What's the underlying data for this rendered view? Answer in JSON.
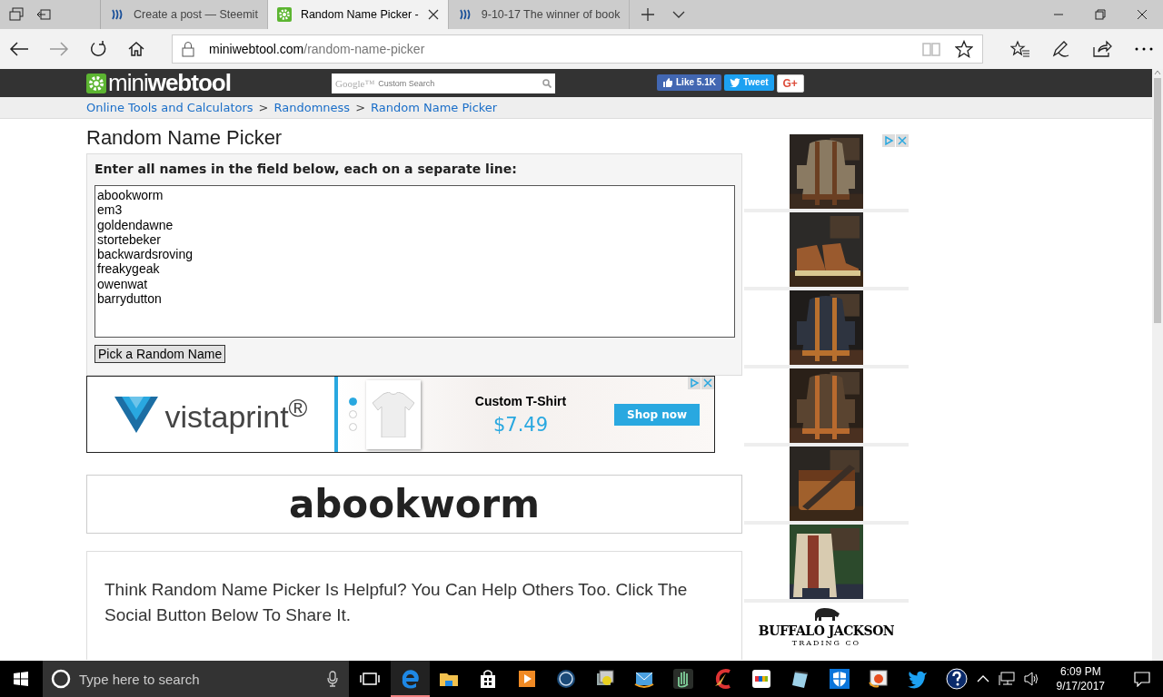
{
  "browser": {
    "tabs": [
      {
        "title": "Create a post — Steemit",
        "selected": false,
        "kind": "steem"
      },
      {
        "title": "Random Name Picker -",
        "selected": true,
        "kind": "gear"
      },
      {
        "title": "9-10-17 The winner of book",
        "selected": false,
        "kind": "steem"
      }
    ],
    "address": {
      "domain": "miniwebtool.com",
      "path": "/random-name-picker"
    }
  },
  "site": {
    "logo": "mini**webtool**",
    "search": {
      "brand": "Google™",
      "placeholder": "Custom Search"
    },
    "social": [
      {
        "kind": "like",
        "label": "Like",
        "count": "5.1K"
      },
      {
        "kind": "tweet",
        "label": "Tweet"
      },
      {
        "kind": "gplus",
        "label": "G+"
      }
    ],
    "breadcrumb": {
      "separator": ">",
      "items": [
        "Online Tools and Calculators",
        "Randomness",
        "Random Name Picker"
      ]
    }
  },
  "page": {
    "title": "Random Name Picker",
    "instruction": "Enter all names in the field below, each on a separate line:",
    "names": [
      "abookworm",
      "em3",
      "goldendawne",
      "stortebeker",
      "backwardsroving",
      "freakygeak",
      "owenwat",
      "barrydutton"
    ],
    "pick_button": "Pick a Random Name",
    "banner_ad": {
      "brand": "vistaprint$^{®}$",
      "product": "Custom T-Shirt",
      "price": "$7.49",
      "cta": "Shop now",
      "slides": [
        {
          "selected": true
        },
        {
          "selected": false
        },
        {
          "selected": false
        }
      ]
    },
    "result": "abookworm",
    "share_text": "Think Random Name Picker Is Helpful? You Can Help Others Too. Click The Social Button Below To Share It.",
    "side_ad": {
      "brand": "BUFFALO JACKSON",
      "brand_sub": "TRADING CO"
    }
  },
  "taskbar": {
    "search_placeholder": "Type here to search",
    "time": "6:09 PM",
    "date": "9/17/2017"
  }
}
